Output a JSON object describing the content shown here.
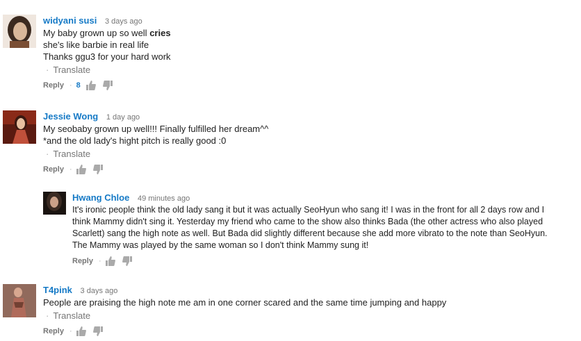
{
  "comments": [
    {
      "author": "widyani susi",
      "time": "3 days ago",
      "lines": [
        "My baby grown up so well ",
        "cries",
        "she's like barbie in real life",
        "Thanks ggu3 for your hard work"
      ],
      "translate": "Translate",
      "reply": "Reply",
      "likes": "8",
      "avatar_colors": [
        "#3b2a20",
        "#d8b79a",
        "#7a4e34"
      ]
    },
    {
      "author": "Jessie Wong",
      "time": "1 day ago",
      "lines": [
        "My seobaby grown up well!!! Finally fulfilled her dream^^",
        "*and the old lady's hight pitch is really good :0"
      ],
      "translate": "Translate",
      "reply": "Reply",
      "avatar_colors": [
        "#5a1a10",
        "#c0503a",
        "#e8c0a0"
      ]
    },
    {
      "author": "Hwang Chloe",
      "time": "49 minutes ago",
      "lines": [
        "It's ironic people think the old lady sang it but it was actually SeoHyun who sang it! I was in the front for all 2 days row and I",
        "think Mammy didn't sing it. Yesterday my friend who came to the show also thinks Bada (the other actress who also played",
        "Scarlett) sang the high note as well. But Bada did slightly different because she add more vibrato to the note than SeoHyun.",
        "The Mammy was played by the same woman so I don't think Mammy sung it!"
      ],
      "reply": "Reply",
      "avatar_colors": [
        "#1a1410",
        "#caa088",
        "#3a2a22"
      ]
    },
    {
      "author": "T4pink",
      "time": "3 days ago",
      "lines": [
        "People are praising the high note me am in one corner scared and the same time jumping and happy"
      ],
      "translate": "Translate",
      "reply": "Reply",
      "avatar_colors": [
        "#4a2418",
        "#b06a5a",
        "#d8a890"
      ]
    }
  ]
}
